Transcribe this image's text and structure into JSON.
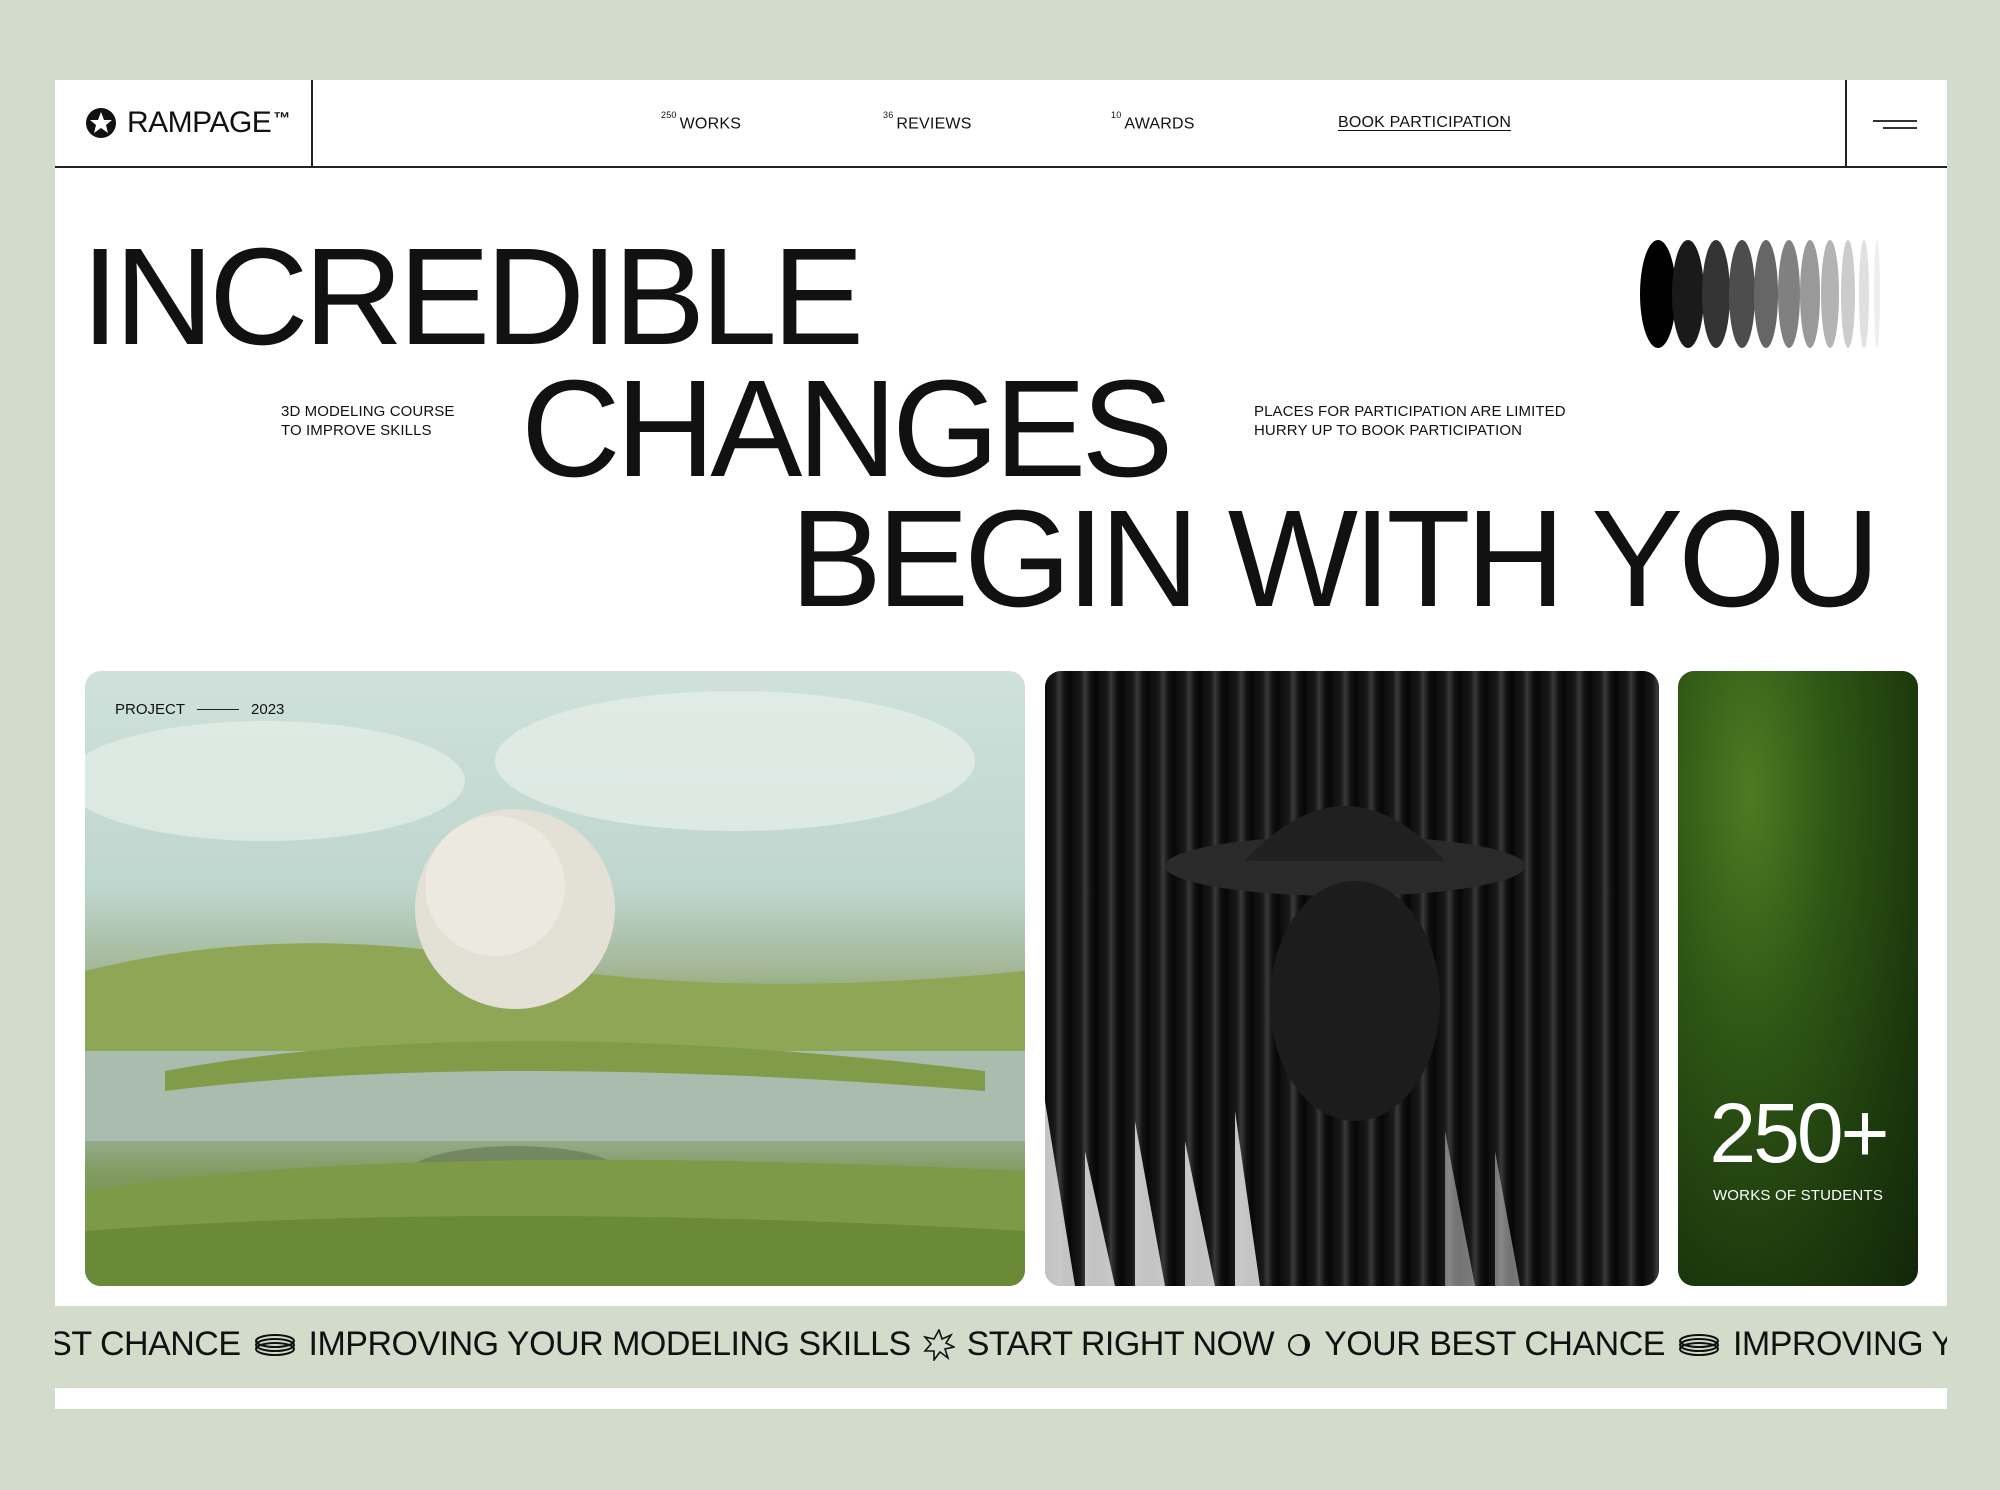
{
  "brand": {
    "name": "RAMPAGE",
    "tm": "™"
  },
  "nav": {
    "works": {
      "count": "250",
      "label": "WORKS"
    },
    "reviews": {
      "count": "36",
      "label": "REVIEWS"
    },
    "awards": {
      "count": "10",
      "label": "AWARDS"
    },
    "cta": "BOOK PARTICIPATION"
  },
  "hero": {
    "line1": "INCREDIBLE",
    "line2": "CHANGES",
    "line3": "BEGIN WITH YOU",
    "left_note": [
      "3D MODELING COURSE",
      "TO IMPROVE SKILLS"
    ],
    "right_note": [
      "PLACES FOR PARTICIPATION ARE LIMITED",
      "HURRY UP TO BOOK PARTICIPATION"
    ]
  },
  "cards": {
    "project_label": "PROJECT",
    "project_year": "2023",
    "stat_value": "250+",
    "stat_label": "WORKS OF STUDENTS"
  },
  "marquee": [
    "EST CHANCE",
    "IMPROVING YOUR MODELING SKILLS",
    "START RIGHT NOW",
    "YOUR BEST CHANCE",
    "IMPROVING YOUR MODELING"
  ],
  "colors": {
    "background": "#d3dccb",
    "page": "#ffffff",
    "text": "#111111"
  }
}
